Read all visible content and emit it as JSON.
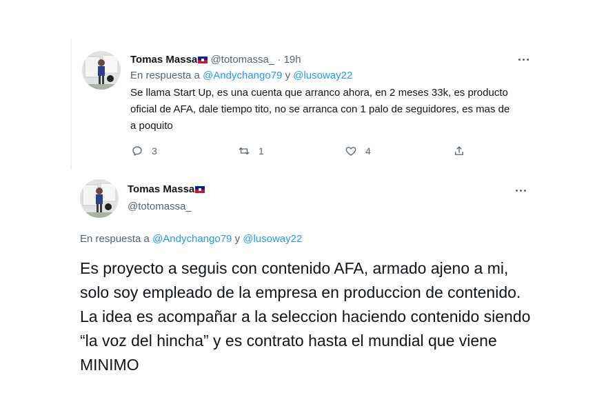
{
  "reply": {
    "author_name": "Tomas Massa",
    "author_handle": "@totomassa_",
    "separator": "·",
    "time": "19h",
    "in_reply_prefix": "En respuesta a",
    "in_reply_user1": "@Andychango79",
    "in_reply_conj": "y",
    "in_reply_user2": "@lusoway22",
    "text": "Se llama Start Up, es una cuenta que arranco ahora, en 2 meses 33k, es producto oficial de AFA, dale tiempo tito, no se arranca con 1 palo de seguidores, es mas de a poquito",
    "actions": {
      "replies": "3",
      "retweets": "1",
      "likes": "4"
    },
    "icons": [
      "flag-haiti-icon",
      "more-dots-icon",
      "reply-icon",
      "retweet-icon",
      "like-icon",
      "share-icon"
    ]
  },
  "main": {
    "author_name": "Tomas Massa",
    "author_handle": "@totomassa_",
    "in_reply_prefix": "En respuesta a",
    "in_reply_user1": "@Andychango79",
    "in_reply_conj": "y",
    "in_reply_user2": "@lusoway22",
    "text": "Es proyecto a seguis con contenido AFA, armado ajeno a mi, solo soy empleado de la empresa en produccion de contenido. La idea es acompañar a la seleccion haciendo contenido siendo “la voz del hincha” y es contrato hasta el mundial que viene MINIMO"
  },
  "colors": {
    "link": "#1d9bf0",
    "muted": "#536471",
    "text": "#0f1419"
  }
}
